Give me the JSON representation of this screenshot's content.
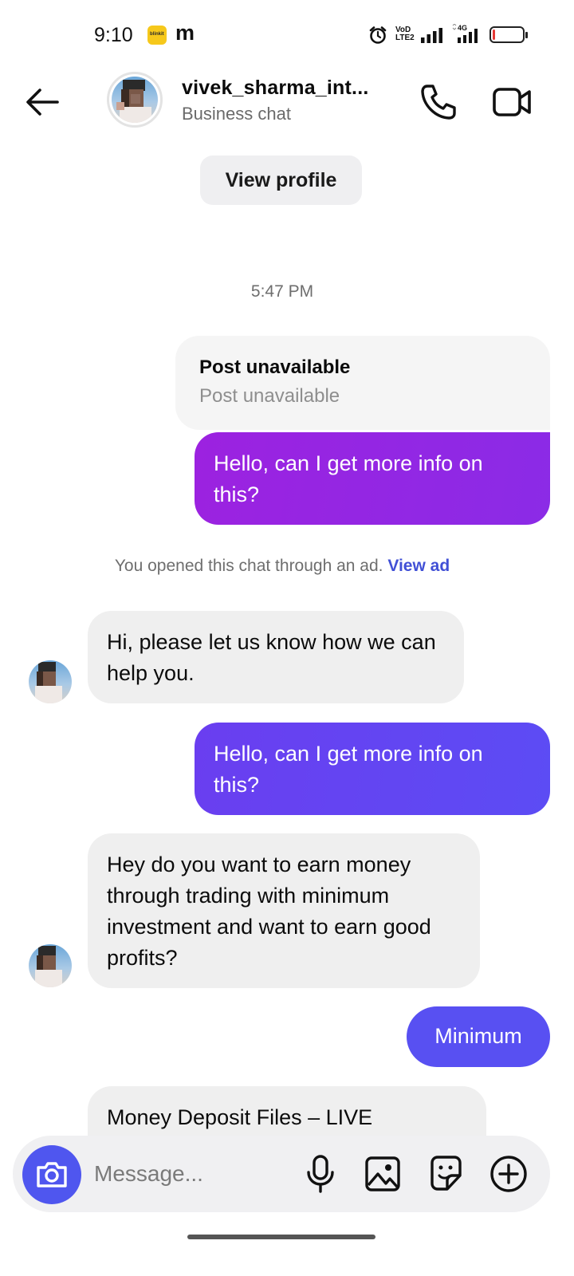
{
  "status_bar": {
    "time": "9:10",
    "blinkit_label": "blinkit",
    "m_label": "m",
    "network_label_1": "VoD",
    "network_label_2": "LTE2",
    "network_label_3": "4G",
    "battery_level": 0.08,
    "battery_color": "#e53935"
  },
  "header": {
    "contact_name": "vivek_sharma_int...",
    "contact_subtitle": "Business chat",
    "icons": [
      "arrow-left-icon",
      "phone-icon",
      "video-camera-icon"
    ]
  },
  "view_profile_label": "View profile",
  "timestamp": "5:47 PM",
  "post_card": {
    "title": "Post unavailable",
    "subtitle": "Post unavailable"
  },
  "messages": [
    {
      "direction": "outgoing",
      "text": "Hello, can I get more info on this?",
      "color": "#9c22e0"
    },
    {
      "direction": "incoming",
      "text": "Hi, please let us know how we can help you."
    },
    {
      "direction": "outgoing",
      "text": "Hello, can I get more info on this?",
      "color": "#6a3ef0"
    },
    {
      "direction": "incoming",
      "text": "Hey do you want to earn money through trading with minimum investment and want to earn good profits?"
    },
    {
      "direction": "outgoing",
      "text": "Minimum",
      "color": "#5850f2"
    },
    {
      "direction": "incoming",
      "text": "Money Deposit Files – LIVE"
    }
  ],
  "ad_notice": {
    "text": "You opened this chat through an ad.",
    "link": "View ad",
    "link_color": "#4150d6"
  },
  "composer": {
    "placeholder": "Message...",
    "accent_color": "#4f56ef",
    "icons": [
      "camera-icon",
      "microphone-icon",
      "gallery-icon",
      "sticker-icon",
      "plus-circle-icon"
    ]
  }
}
